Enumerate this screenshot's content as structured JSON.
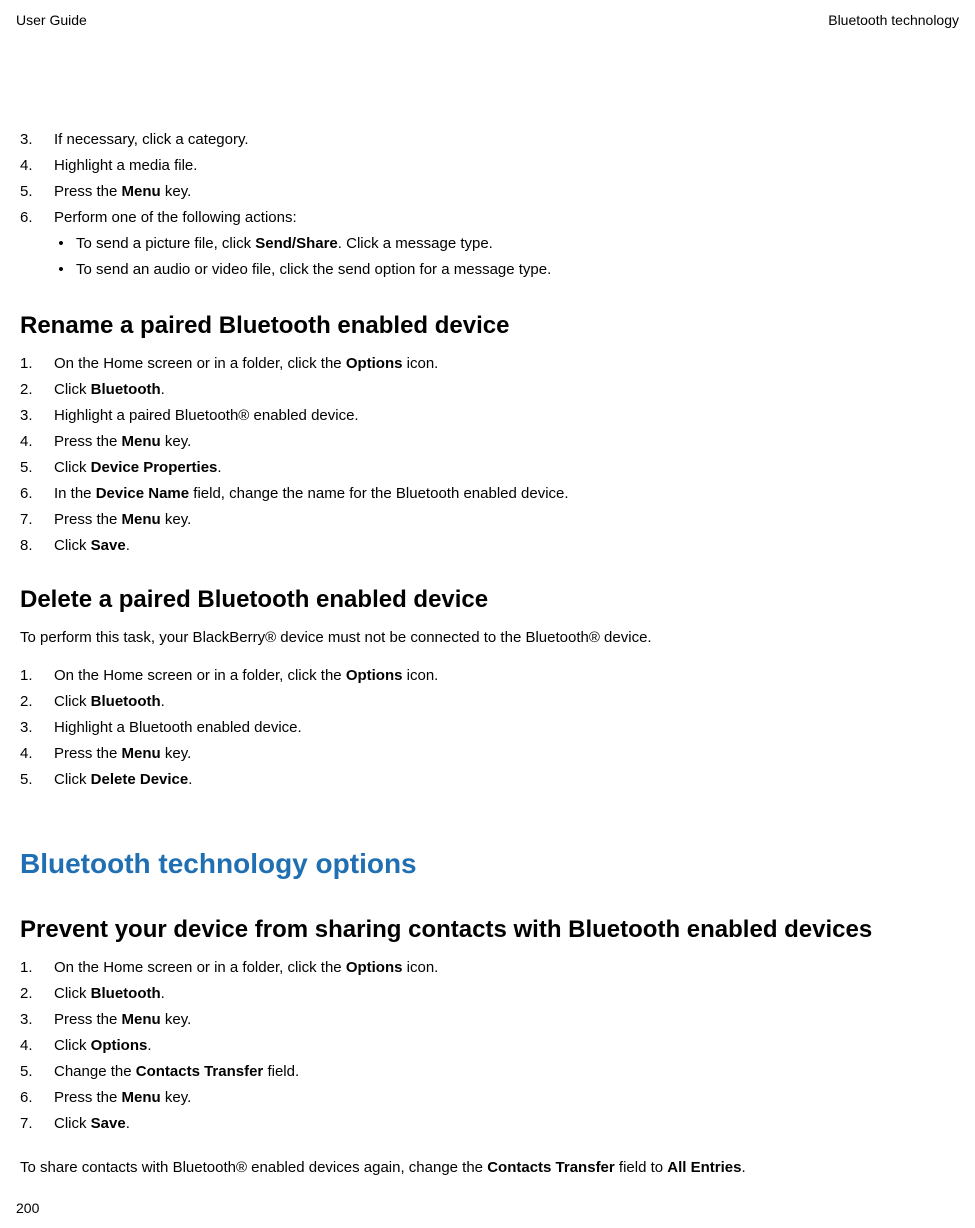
{
  "header": {
    "left": "User Guide",
    "right": "Bluetooth technology"
  },
  "topSteps": {
    "items": [
      {
        "n": "3.",
        "segments": [
          {
            "t": "If necessary, click a category."
          }
        ]
      },
      {
        "n": "4.",
        "segments": [
          {
            "t": "Highlight a media file."
          }
        ]
      },
      {
        "n": "5.",
        "segments": [
          {
            "t": "Press the "
          },
          {
            "t": "Menu",
            "b": true
          },
          {
            "t": " key."
          }
        ]
      },
      {
        "n": "6.",
        "segments": [
          {
            "t": "Perform one of the following actions:"
          }
        ],
        "bullets": [
          [
            {
              "t": "To send a picture file, click "
            },
            {
              "t": "Send/Share",
              "b": true
            },
            {
              "t": ". Click a message type."
            }
          ],
          [
            {
              "t": "To send an audio or video file, click the send option for a message type."
            }
          ]
        ]
      }
    ]
  },
  "section1": {
    "heading": "Rename a paired Bluetooth enabled device",
    "items": [
      {
        "n": "1.",
        "segments": [
          {
            "t": "On the Home screen or in a folder, click the "
          },
          {
            "t": "Options",
            "b": true
          },
          {
            "t": " icon."
          }
        ]
      },
      {
        "n": "2.",
        "segments": [
          {
            "t": "Click "
          },
          {
            "t": "Bluetooth",
            "b": true
          },
          {
            "t": "."
          }
        ]
      },
      {
        "n": "3.",
        "segments": [
          {
            "t": "Highlight a paired Bluetooth® enabled device."
          }
        ]
      },
      {
        "n": "4.",
        "segments": [
          {
            "t": "Press the "
          },
          {
            "t": "Menu",
            "b": true
          },
          {
            "t": " key."
          }
        ]
      },
      {
        "n": "5.",
        "segments": [
          {
            "t": "Click "
          },
          {
            "t": "Device Properties",
            "b": true
          },
          {
            "t": "."
          }
        ]
      },
      {
        "n": "6.",
        "segments": [
          {
            "t": "In the "
          },
          {
            "t": "Device Name",
            "b": true
          },
          {
            "t": " field, change the name for the Bluetooth enabled device."
          }
        ]
      },
      {
        "n": "7.",
        "segments": [
          {
            "t": "Press the "
          },
          {
            "t": "Menu",
            "b": true
          },
          {
            "t": " key."
          }
        ]
      },
      {
        "n": "8.",
        "segments": [
          {
            "t": "Click "
          },
          {
            "t": "Save",
            "b": true
          },
          {
            "t": "."
          }
        ]
      }
    ]
  },
  "section2": {
    "heading": "Delete a paired Bluetooth enabled device",
    "intro": "To perform this task, your BlackBerry® device must not be connected to the Bluetooth® device.",
    "items": [
      {
        "n": "1.",
        "segments": [
          {
            "t": "On the Home screen or in a folder, click the "
          },
          {
            "t": "Options",
            "b": true
          },
          {
            "t": " icon."
          }
        ]
      },
      {
        "n": "2.",
        "segments": [
          {
            "t": "Click "
          },
          {
            "t": "Bluetooth",
            "b": true
          },
          {
            "t": "."
          }
        ]
      },
      {
        "n": "3.",
        "segments": [
          {
            "t": "Highlight a Bluetooth enabled device."
          }
        ]
      },
      {
        "n": "4.",
        "segments": [
          {
            "t": "Press the "
          },
          {
            "t": "Menu",
            "b": true
          },
          {
            "t": " key."
          }
        ]
      },
      {
        "n": "5.",
        "segments": [
          {
            "t": "Click "
          },
          {
            "t": "Delete Device",
            "b": true
          },
          {
            "t": "."
          }
        ]
      }
    ]
  },
  "majorSection": {
    "title": "Bluetooth technology options"
  },
  "section3": {
    "heading": "Prevent your device from sharing contacts with Bluetooth enabled devices",
    "items": [
      {
        "n": "1.",
        "segments": [
          {
            "t": "On the Home screen or in a folder, click the "
          },
          {
            "t": "Options",
            "b": true
          },
          {
            "t": " icon."
          }
        ]
      },
      {
        "n": "2.",
        "segments": [
          {
            "t": "Click "
          },
          {
            "t": "Bluetooth",
            "b": true
          },
          {
            "t": "."
          }
        ]
      },
      {
        "n": "3.",
        "segments": [
          {
            "t": "Press the "
          },
          {
            "t": "Menu",
            "b": true
          },
          {
            "t": " key."
          }
        ]
      },
      {
        "n": "4.",
        "segments": [
          {
            "t": "Click "
          },
          {
            "t": "Options",
            "b": true
          },
          {
            "t": "."
          }
        ]
      },
      {
        "n": "5.",
        "segments": [
          {
            "t": "Change the "
          },
          {
            "t": "Contacts Transfer",
            "b": true
          },
          {
            "t": " field."
          }
        ]
      },
      {
        "n": "6.",
        "segments": [
          {
            "t": "Press the "
          },
          {
            "t": "Menu",
            "b": true
          },
          {
            "t": " key."
          }
        ]
      },
      {
        "n": "7.",
        "segments": [
          {
            "t": "Click "
          },
          {
            "t": "Save",
            "b": true
          },
          {
            "t": "."
          }
        ]
      }
    ],
    "outroSegments": [
      {
        "t": "To share contacts with Bluetooth® enabled devices again, change the "
      },
      {
        "t": "Contacts Transfer",
        "b": true
      },
      {
        "t": " field to "
      },
      {
        "t": "All Entries",
        "b": true
      },
      {
        "t": "."
      }
    ]
  },
  "pageNumber": "200"
}
